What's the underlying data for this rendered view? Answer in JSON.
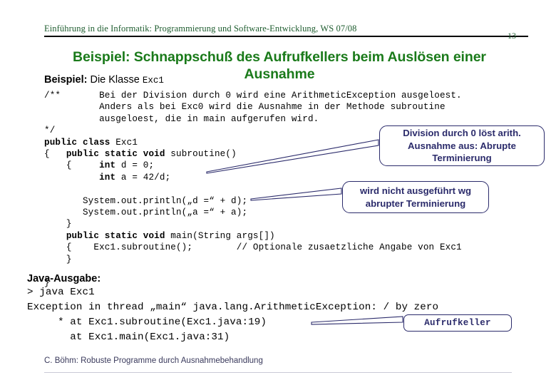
{
  "header": {
    "course_line": "Einführung in die Informatik: Programmierung und Software-Entwicklung, WS 07/08",
    "slide_number": "13"
  },
  "title": "Beispiel: Schnappschuß des Aufrufkellers beim Auslösen einer Ausnahme",
  "subtitle": {
    "bold_part": "Beispiel:",
    "plain_part": " Die Klasse ",
    "mono_part": "Exc1"
  },
  "code": {
    "lines": [
      {
        "text": "/**       Bei der Division durch 0 wird eine ArithmeticException ausgeloest.",
        "bold": false
      },
      {
        "text": "          Anders als bei Exc0 wird die Ausnahme in der Methode subroutine",
        "bold": false
      },
      {
        "text": "          ausgeloest, die in main aufgerufen wird.",
        "bold": false
      },
      {
        "text": "*/",
        "bold": false
      },
      {
        "text": "public class ",
        "bold": true,
        "tail": "Exc1"
      },
      {
        "text": "{   public static void ",
        "bold": true,
        "tail": "subroutine()",
        "bold_start": 4
      },
      {
        "text": "    {     int ",
        "bold": true,
        "tail": "d = 0;"
      },
      {
        "text": "          int ",
        "bold": true,
        "tail": "a = 42/d;"
      },
      {
        "text": "",
        "bold": false
      },
      {
        "text": "      System.out.println(„d =“ + d);",
        "bold": false
      },
      {
        "text": "      System.out.println(„a =“ + a);",
        "bold": false
      },
      {
        "text": "    }",
        "bold": false
      },
      {
        "text": "    public static void ",
        "bold": true,
        "tail": "main(String args[])"
      },
      {
        "text": "    {    Exc1.subroutine();        // Optionale zusaetzliche Angabe von Exc1",
        "bold": false
      },
      {
        "text": "    }",
        "bold": false
      },
      {
        "text": "",
        "bold": false
      },
      {
        "text": "}",
        "bold": false
      }
    ],
    "full_text": "/**       Bei der Division durch 0 wird eine ArithmeticException ausgeloest.\n          Anders als bei Exc0 wird die Ausnahme in der Methode subroutine\n          ausgeloest, die in main aufgerufen wird.\n*/"
  },
  "code_segments": [
    [
      {
        "t": "/**       Bei der Division durch 0 wird eine ArithmeticException ausgeloest.",
        "b": false
      }
    ],
    [
      {
        "t": "          Anders als bei Exc0 wird die Ausnahme in der Methode subroutine",
        "b": false
      }
    ],
    [
      {
        "t": "          ausgeloest, die in main aufgerufen wird.",
        "b": false
      }
    ],
    [
      {
        "t": "*/",
        "b": false
      }
    ],
    [
      {
        "t": "public class ",
        "b": true
      },
      {
        "t": "Exc1",
        "b": false
      }
    ],
    [
      {
        "t": "{   ",
        "b": false
      },
      {
        "t": "public static void ",
        "b": true
      },
      {
        "t": "subroutine()",
        "b": false
      }
    ],
    [
      {
        "t": "    {     ",
        "b": false
      },
      {
        "t": "int ",
        "b": true
      },
      {
        "t": "d = 0;",
        "b": false
      }
    ],
    [
      {
        "t": "          ",
        "b": false
      },
      {
        "t": "int ",
        "b": true
      },
      {
        "t": "a = 42/d;",
        "b": false
      }
    ],
    [
      {
        "t": " ",
        "b": false
      }
    ],
    [
      {
        "t": "       System.out.println(„d =“ + d);",
        "b": false
      }
    ],
    [
      {
        "t": "       System.out.println(„a =“ + a);",
        "b": false
      }
    ],
    [
      {
        "t": "    }",
        "b": false
      }
    ],
    [
      {
        "t": "    ",
        "b": false
      },
      {
        "t": "public static void ",
        "b": true
      },
      {
        "t": "main(String args[])",
        "b": false
      }
    ],
    [
      {
        "t": "    {    Exc1.subroutine();        // Optionale zusaetzliche Angabe von Exc1",
        "b": false
      }
    ],
    [
      {
        "t": "    }",
        "b": false
      }
    ],
    [
      {
        "t": " ",
        "b": false
      }
    ],
    [
      {
        "t": "}",
        "b": false
      }
    ]
  ],
  "output": {
    "label": "Java-Ausgabe:",
    "lines": [
      "> java Exc1",
      "Exception in thread „main“ java.lang.ArithmeticException: / by zero",
      "     * at Exc1.subroutine(Exc1.java:19)",
      "       at Exc1.main(Exc1.java:31)"
    ]
  },
  "callouts": {
    "division": "Division durch 0 löst arith. Ausnahme aus: Abrupte Terminierung",
    "nicht_ausgefuehrt": "wird nicht ausgeführt wg abrupter Terminierung",
    "aufrufkeller": "Aufrufkeller"
  },
  "footer": "C. Böhm: Robuste Programme durch Ausnahmebehandlung",
  "colors": {
    "header_green": "#1d5c2e",
    "title_green": "#1a7a1a",
    "callout_navy": "#2b2b6b",
    "footer_gray": "#3a3a5c"
  }
}
